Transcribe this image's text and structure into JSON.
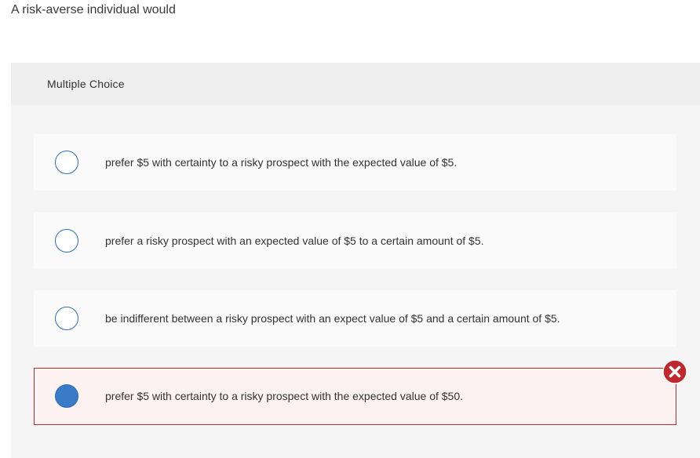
{
  "question": {
    "text": "A risk-averse individual would"
  },
  "panel": {
    "title": "Multiple Choice"
  },
  "options": [
    {
      "text": "prefer $5 with certainty to a risky prospect with the expected value of $5.",
      "selected": false
    },
    {
      "text": "prefer a risky prospect with an expected value of $5 to a certain amount of $5.",
      "selected": false
    },
    {
      "text": "be indifferent between a risky prospect with an expect value of $5 and a certain amount of $5.",
      "selected": false
    },
    {
      "text": "prefer $5 with certainty to a risky prospect with the expected value of $50.",
      "selected": true,
      "status": "incorrect"
    }
  ],
  "icons": {
    "radio": "radio-icon",
    "wrong": "x-circle-icon"
  },
  "colors": {
    "radio_border": "#2f6db5",
    "radio_fill": "#3a7bc8",
    "wrong_border": "#b52a2a",
    "wrong_icon": "#c0282d"
  }
}
